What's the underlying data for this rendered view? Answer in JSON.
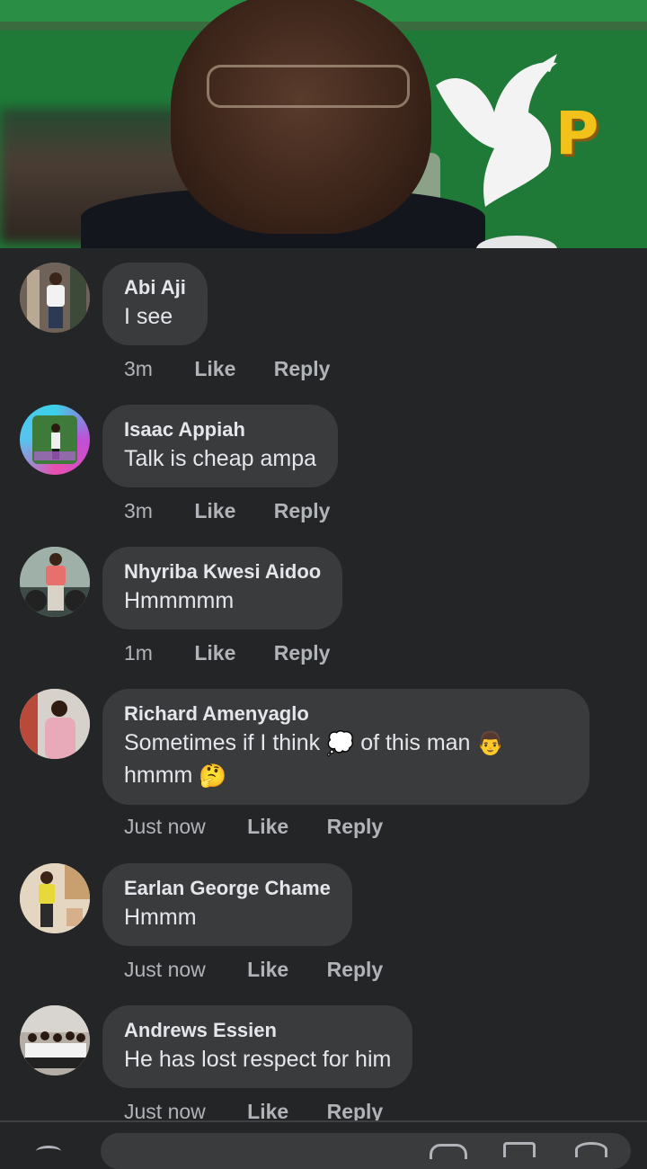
{
  "video": {
    "logo_text": "P"
  },
  "comments": [
    {
      "name": "Abi Aji",
      "text": "I see",
      "time": "3m",
      "like": "Like",
      "reply": "Reply"
    },
    {
      "name": "Isaac Appiah",
      "text": "Talk is cheap ampa",
      "time": "3m",
      "like": "Like",
      "reply": "Reply"
    },
    {
      "name": "Nhyriba Kwesi Aidoo",
      "text": "Hmmmmm",
      "time": "1m",
      "like": "Like",
      "reply": "Reply"
    },
    {
      "name": "Richard Amenyaglo",
      "text_line1": "Sometimes if I think",
      "text_mid": "of this man",
      "text_line2": "hmmm",
      "emoji_thought": "💭",
      "emoji_man": "👨",
      "emoji_think": "🤔",
      "time": "Just now",
      "like": "Like",
      "reply": "Reply"
    },
    {
      "name": "Earlan George Chame",
      "text": "Hmmm",
      "time": "Just now",
      "like": "Like",
      "reply": "Reply"
    },
    {
      "name": "Andrews Essien",
      "text": "He has lost respect for him",
      "time": "Just now",
      "like": "Like",
      "reply": "Reply"
    }
  ],
  "colors": {
    "background": "#242526",
    "bubble": "#3a3b3c",
    "text": "#e4e6eb",
    "meta": "#b0b3b8"
  }
}
